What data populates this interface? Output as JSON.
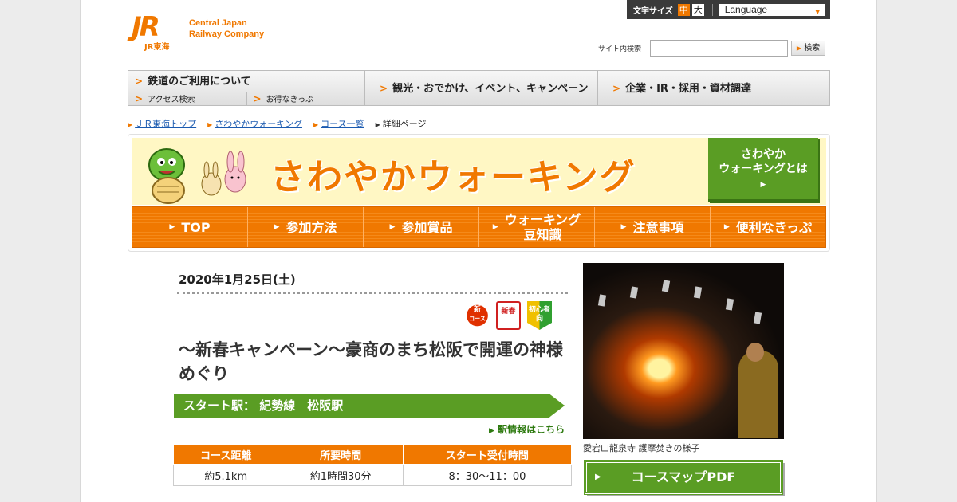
{
  "header": {
    "logo_mark": "JR",
    "logo_sub": "JR東海",
    "company_line1": "Central Japan",
    "company_line2": "Railway Company",
    "font_size_label": "文字サイズ",
    "font_size_mid": "中",
    "font_size_big": "大",
    "language_label": "Language",
    "search_label": "サイト内検索",
    "search_value": "",
    "search_button": "検索"
  },
  "gnav": {
    "rail": "鉄道のご利用について",
    "access": "アクセス検索",
    "tickets": "お得なきっぷ",
    "tourism": "観光・おでかけ、イベント、キャンペーン",
    "corporate": "企業・IR・採用・資材調達"
  },
  "breadcrumb": {
    "items": [
      "ＪＲ東海トップ",
      "さわやかウォーキング",
      "コース一覧"
    ],
    "current": "詳細ページ"
  },
  "banner": {
    "title": "さわやかウォーキング",
    "about_line1": "さわやか",
    "about_line2": "ウォーキングとは"
  },
  "subnav": {
    "items": [
      "TOP",
      "参加方法",
      "参加賞品",
      "ウォーキング",
      "注意事項",
      "便利なきっぷ"
    ],
    "item4_line2": "豆知識"
  },
  "course": {
    "date": "2020年1月25日(土)",
    "badge_new": "新",
    "badge_new_sub": "コース",
    "badge_spring": "新春",
    "badge_beginner": "初心者向",
    "title": "～新春キャンペーン～豪商のまち松阪で開運の神様めぐり",
    "start_label": "スタート駅：  紀勢線　松阪駅",
    "station_link": "駅情報はこちら",
    "table_headers": [
      "コース距離",
      "所要時間",
      "スタート受付時間"
    ],
    "table_values": [
      "約5.1km",
      "約1時間30分",
      "8：30～11：00"
    ],
    "photo_caption": "愛宕山龍泉寺 護摩焚きの様子",
    "pdf_button": "コースマップPDF"
  },
  "colors": {
    "accent": "#f07800",
    "green": "#5a9d24",
    "banner_bg": "#fff7c4"
  }
}
